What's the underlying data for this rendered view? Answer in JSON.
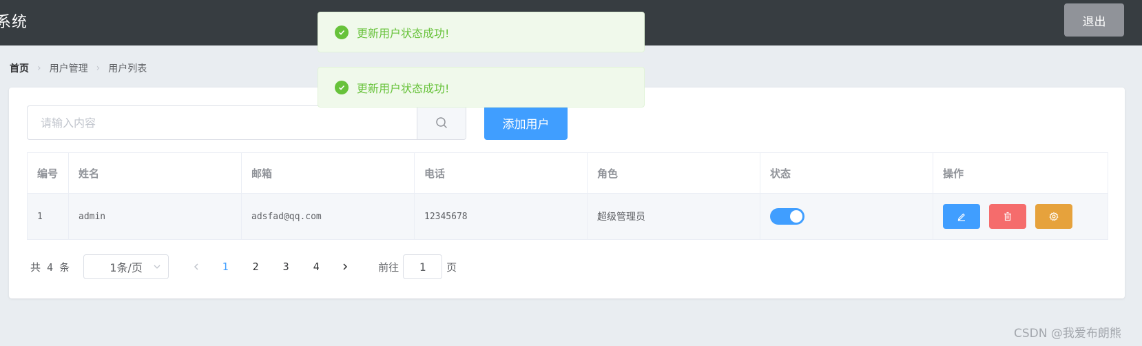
{
  "header": {
    "title": "系统",
    "logout_label": "退出"
  },
  "breadcrumb": [
    "首页",
    "用户管理",
    "用户列表"
  ],
  "search": {
    "placeholder": "请输入内容",
    "value": ""
  },
  "add_button_label": "添加用户",
  "table": {
    "columns": [
      "编号",
      "姓名",
      "邮箱",
      "电话",
      "角色",
      "状态",
      "操作"
    ],
    "rows": [
      {
        "id": "1",
        "name": "admin",
        "email": "adsfad@qq.com",
        "phone": "12345678",
        "role": "超级管理员",
        "status": true
      }
    ]
  },
  "pagination": {
    "total_text": "共 4 条",
    "page_size_label": "1条/页",
    "pages": [
      "1",
      "2",
      "3",
      "4"
    ],
    "current_page": "1",
    "goto_label": "前往",
    "goto_value": "1",
    "page_suffix": "页"
  },
  "toasts": [
    "更新用户状态成功!",
    "更新用户状态成功!"
  ],
  "watermark": "CSDN @我爱布朗熊",
  "colors": {
    "primary": "#409eff",
    "danger": "#f56c6c",
    "warning": "#e6a23c",
    "success": "#67c23a",
    "header_bg": "#373d41",
    "logout_bg": "#909399"
  },
  "icons": {
    "search": "search-icon",
    "edit": "edit-icon",
    "delete": "trash-icon",
    "settings": "gear-icon",
    "success": "check-circle-icon"
  }
}
